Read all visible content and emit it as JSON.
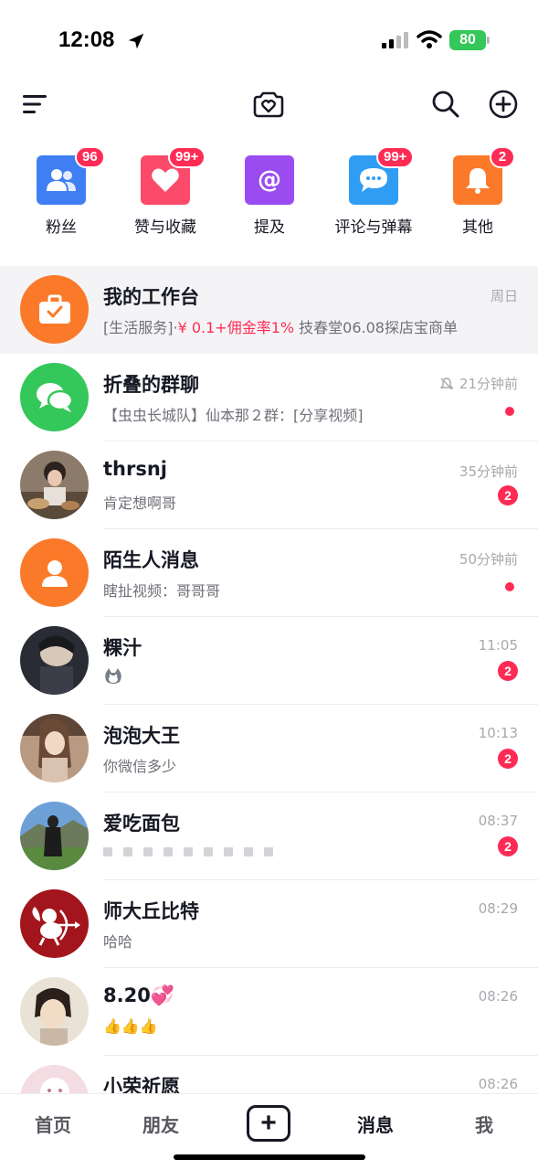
{
  "status_bar": {
    "time": "12:08",
    "battery": "80"
  },
  "colors": {
    "accent": "#fe2c55",
    "fans": "#3f7ff3",
    "likes": "#fb4a6a",
    "mentions": "#9a4cf0",
    "comments": "#2f9df3",
    "other": "#fa7a2a",
    "wechat_green": "#34c759",
    "orange": "#fa7a2a"
  },
  "toolbar": {
    "menu_icon": "menu-icon",
    "camera_icon": "heart-camera-icon",
    "search_icon": "search-icon",
    "add_icon": "add-circle-icon"
  },
  "categories": [
    {
      "label": "粉丝",
      "badge": "96",
      "icon": "fans-icon"
    },
    {
      "label": "赞与收藏",
      "badge": "99+",
      "icon": "heart-icon"
    },
    {
      "label": "提及",
      "badge": "",
      "icon": "at-icon"
    },
    {
      "label": "评论与弹幕",
      "badge": "99+",
      "icon": "comment-icon"
    },
    {
      "label": "其他",
      "badge": "2",
      "icon": "bell-icon"
    }
  ],
  "messages": [
    {
      "name": "我的工作台",
      "time": "周日",
      "sub_prefix": "[生活服务]·",
      "sub_red": "¥ 0.1+佣金率1%",
      "sub_suffix": " 技春堂06.08探店宝商单",
      "pinned": true,
      "indicator": ""
    },
    {
      "name": "折叠的群聊",
      "time": "21分钟前",
      "muted": true,
      "sub": "【虫虫长城队】仙本那２群：[分享视频]",
      "indicator": "dot"
    },
    {
      "name": "thrsnj",
      "time": "35分钟前",
      "sub": "肯定想啊哥",
      "indicator": "2"
    },
    {
      "name": "陌生人消息",
      "time": "50分钟前",
      "sub": "瞎扯视频：哥哥哥",
      "indicator": "dot"
    },
    {
      "name": "粿汁",
      "time": "11:05",
      "sub": "",
      "indicator": "2"
    },
    {
      "name": "泡泡大王",
      "time": "10:13",
      "sub": "你微信多少",
      "indicator": "2"
    },
    {
      "name": "爱吃面包",
      "time": "08:37",
      "sub": "",
      "indicator": "2"
    },
    {
      "name": "师大丘比特",
      "time": "08:29",
      "sub": "哈哈",
      "indicator": ""
    },
    {
      "name": "8.20💞",
      "time": "08:26",
      "sub": "👍👍👍",
      "indicator": ""
    },
    {
      "name": "小荣祈愿",
      "time": "08:26",
      "sub": "",
      "indicator": ""
    }
  ],
  "bottom_nav": {
    "home": "首页",
    "friends": "朋友",
    "messages": "消息",
    "me": "我"
  }
}
